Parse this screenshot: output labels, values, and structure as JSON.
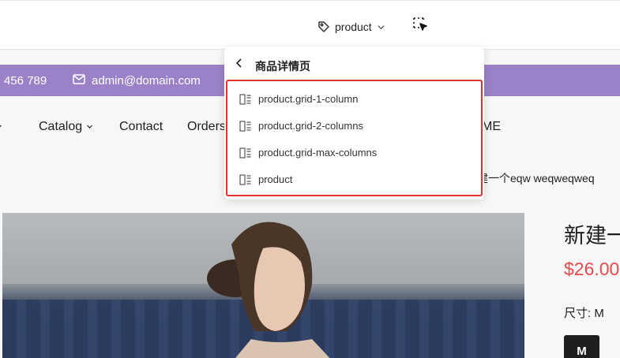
{
  "toolbar": {
    "template_label": "product",
    "template_icon": "tag-icon",
    "inspect_icon": "select-element-icon"
  },
  "preview": {
    "announcement": {
      "phone": "456 789",
      "email": "admin@domain.com",
      "bg_color": "#9b82c8"
    },
    "nav": {
      "items": [
        "Catalog",
        "Contact",
        "Orders",
        "ME"
      ]
    },
    "breadcrumb_tail": "建一个eqw weqweqweq",
    "product": {
      "title": "新建一",
      "price": "$26.00",
      "size_label": "尺寸: M",
      "size_option": "M",
      "price_color": "#e64b4b"
    }
  },
  "dropdown": {
    "title": "商品详情页",
    "items": [
      {
        "label": "product.grid-1-column"
      },
      {
        "label": "product.grid-2-columns"
      },
      {
        "label": "product.grid-max-columns"
      },
      {
        "label": "product"
      }
    ],
    "highlight_color": "#e0332f"
  }
}
